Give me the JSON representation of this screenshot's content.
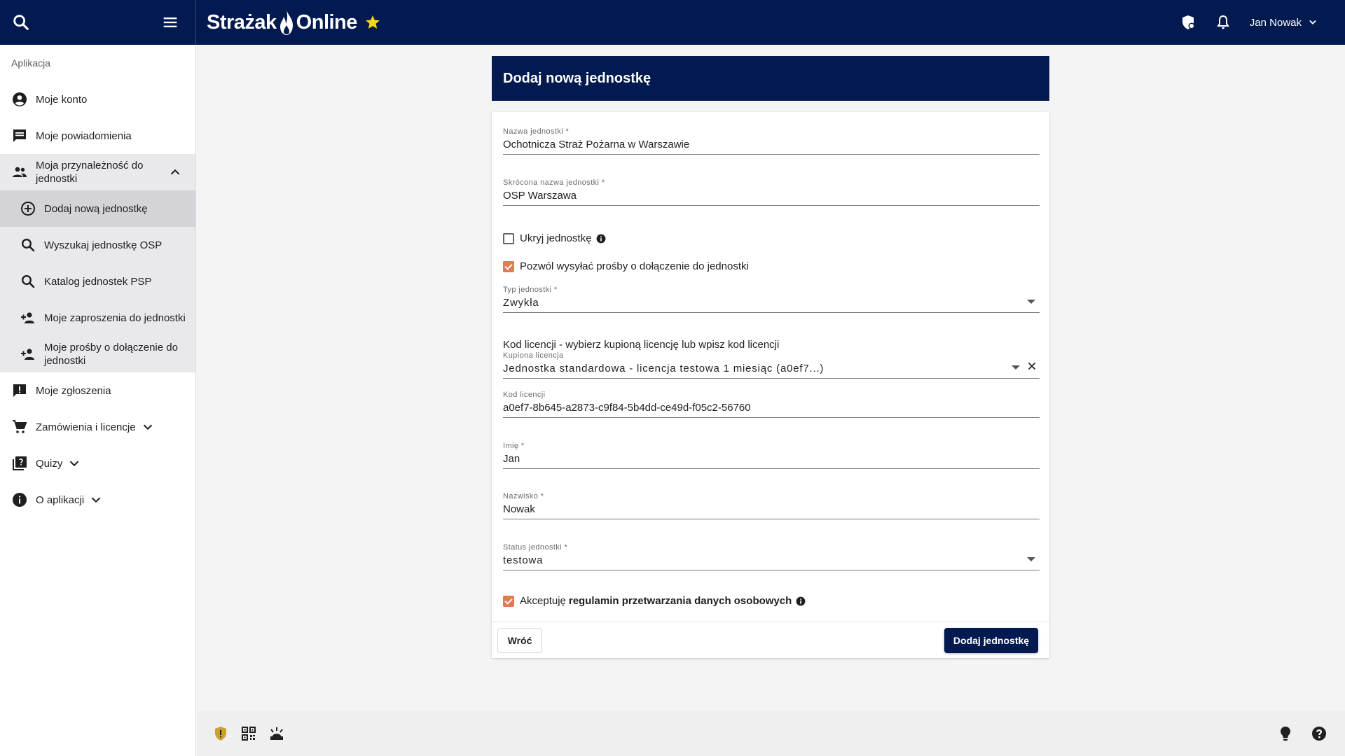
{
  "topbar": {
    "brand_left": "Strażak",
    "brand_right": "Online",
    "user_name": "Jan Nowak",
    "colors": {
      "bar": "#021a4f",
      "star": "#f5d90a"
    },
    "icons": [
      "search-icon",
      "menu-icon",
      "shield-icon",
      "bell-icon",
      "chevron-down-icon"
    ]
  },
  "sidebar": {
    "section": "Aplikacja",
    "items": [
      {
        "label": "Moje konto",
        "icon": "account-circle-icon"
      },
      {
        "label": "Moje powiadomienia",
        "icon": "message-icon"
      },
      {
        "label_line1": "Moja przynależność do",
        "label_line2": "jednostki",
        "icon": "group-icon"
      },
      {
        "label": "Dodaj nową jednostkę",
        "icon": "add-circle-icon"
      },
      {
        "label": "Wyszukaj jednostkę OSP",
        "icon": "search-icon"
      },
      {
        "label": "Katalog jednostek PSP",
        "icon": "search-icon"
      },
      {
        "label": "Moje zaproszenia do jednostki",
        "icon": "person-add-icon"
      },
      {
        "label_line1": "Moje prośby o dołączenie do",
        "label_line2": "jednostki",
        "icon": "person-add-icon"
      },
      {
        "label": "Moje zgłoszenia",
        "icon": "feedback-icon"
      },
      {
        "label": "Zamówienia i licencje",
        "icon": "cart-icon"
      },
      {
        "label": "Quizy",
        "icon": "quiz-icon"
      },
      {
        "label": "O aplikacji",
        "icon": "info-icon"
      }
    ]
  },
  "form": {
    "title": "Dodaj nową jednostkę",
    "unit_name": {
      "label": "Nazwa jednostki *",
      "value": "Ochotnicza Straż Pożarna w Warszawie"
    },
    "short_name": {
      "label": "Skrócona nazwa jednostki *",
      "value": "OSP Warszawa"
    },
    "hide_unit": {
      "label": "Ukryj jednostkę",
      "checked": false
    },
    "allow_requests": {
      "label": "Pozwól wysyłać prośby o dołączenie do jednostki",
      "checked": true
    },
    "unit_type": {
      "label": "Typ jednostki *",
      "value": "Zwykła"
    },
    "license_heading": "Kod licencji - wybierz kupioną licencję lub wpisz kod licencji",
    "purchased_license": {
      "label": "Kupiona licencja",
      "value": "Jednostka standardowa - licencja testowa 1 miesiąc (a0ef7...)"
    },
    "license_code": {
      "label": "Kod licencji",
      "value": "a0ef7-8b645-a2873-c9f84-5b4dd-ce49d-f05c2-56760"
    },
    "first_name": {
      "label": "Imię *",
      "value": "Jan"
    },
    "last_name": {
      "label": "Nazwisko *",
      "value": "Nowak"
    },
    "status": {
      "label": "Status jednostki *",
      "value": "testowa"
    },
    "accept": {
      "label_prefix": "Akceptuję",
      "label_link": "regulamin przetwarzania danych osobowych",
      "checked": true
    },
    "back_label": "Wróć",
    "submit_label": "Dodaj jednostkę",
    "colors": {
      "checkbox": "#e07b54",
      "header": "#021a4f"
    }
  },
  "bottombar": {
    "icons": [
      "shield-alert-icon",
      "qr-code-icon",
      "fire-alarm-icon",
      "lightbulb-icon",
      "help-icon"
    ],
    "colors": {
      "shield": "#c9a227"
    }
  }
}
